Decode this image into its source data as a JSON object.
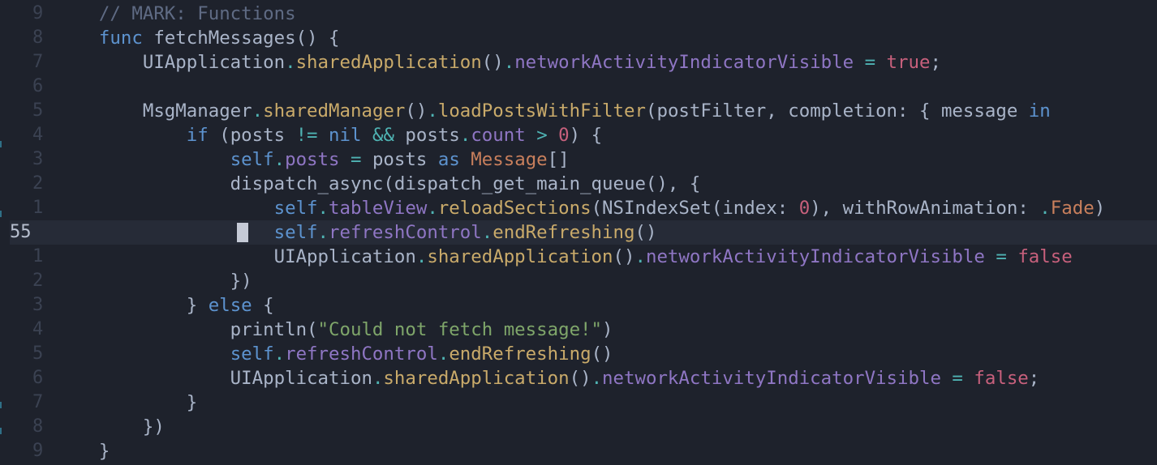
{
  "editor": {
    "current_line_number": "55",
    "lines": [
      {
        "num": "9",
        "tokens": [
          [
            "    ",
            "plain"
          ],
          [
            "// MARK: Functions",
            "comment"
          ]
        ]
      },
      {
        "num": "8",
        "tokens": [
          [
            "    ",
            "plain"
          ],
          [
            "func",
            "kw"
          ],
          [
            " fetchMessages() {",
            "plain"
          ]
        ]
      },
      {
        "num": "7",
        "tokens": [
          [
            "        UIApplication",
            "plain"
          ],
          [
            ".",
            "op"
          ],
          [
            "sharedApplication",
            "fn"
          ],
          [
            "()",
            "plain"
          ],
          [
            ".",
            "op"
          ],
          [
            "networkActivityIndicatorVisible",
            "prop"
          ],
          [
            " ",
            "plain"
          ],
          [
            "=",
            "op"
          ],
          [
            " ",
            "plain"
          ],
          [
            "true",
            "bool"
          ],
          [
            ";",
            "plain"
          ]
        ]
      },
      {
        "num": "6",
        "tokens": []
      },
      {
        "num": "5",
        "tokens": [
          [
            "        MsgManager",
            "plain"
          ],
          [
            ".",
            "op"
          ],
          [
            "sharedManager",
            "fn"
          ],
          [
            "()",
            "plain"
          ],
          [
            ".",
            "op"
          ],
          [
            "loadPostsWithFilter",
            "fn"
          ],
          [
            "(postFilter, completion: { message ",
            "plain"
          ],
          [
            "in",
            "kw"
          ]
        ]
      },
      {
        "num": "4",
        "tokens": [
          [
            "            ",
            "plain"
          ],
          [
            "if",
            "kw"
          ],
          [
            " (posts ",
            "plain"
          ],
          [
            "!=",
            "op"
          ],
          [
            " ",
            "plain"
          ],
          [
            "nil",
            "kw"
          ],
          [
            " ",
            "plain"
          ],
          [
            "&&",
            "op"
          ],
          [
            " posts",
            "plain"
          ],
          [
            ".",
            "op"
          ],
          [
            "count",
            "prop"
          ],
          [
            " ",
            "plain"
          ],
          [
            ">",
            "op"
          ],
          [
            " ",
            "plain"
          ],
          [
            "0",
            "num"
          ],
          [
            ") {",
            "plain"
          ]
        ]
      },
      {
        "num": "3",
        "tokens": [
          [
            "                ",
            "plain"
          ],
          [
            "self",
            "kw"
          ],
          [
            ".",
            "op"
          ],
          [
            "posts",
            "prop"
          ],
          [
            " ",
            "plain"
          ],
          [
            "=",
            "op"
          ],
          [
            " posts ",
            "plain"
          ],
          [
            "as",
            "kw"
          ],
          [
            " ",
            "plain"
          ],
          [
            "Message",
            "type"
          ],
          [
            "[]",
            "plain"
          ]
        ]
      },
      {
        "num": "2",
        "tokens": [
          [
            "                dispatch_async(dispatch_get_main_queue(), {",
            "plain"
          ]
        ]
      },
      {
        "num": "1",
        "tokens": [
          [
            "                    ",
            "plain"
          ],
          [
            "self",
            "kw"
          ],
          [
            ".",
            "op"
          ],
          [
            "tableView",
            "prop"
          ],
          [
            ".",
            "op"
          ],
          [
            "reloadSections",
            "fn"
          ],
          [
            "(NSIndexSet(index: ",
            "plain"
          ],
          [
            "0",
            "num"
          ],
          [
            "), withRowAnimation: ",
            "plain"
          ],
          [
            ".",
            "op"
          ],
          [
            "Fade",
            "type"
          ],
          [
            ")",
            "plain"
          ]
        ]
      },
      {
        "num": "55",
        "current": true,
        "tokens": [
          [
            "                    ",
            "plain"
          ],
          [
            "self",
            "kw"
          ],
          [
            ".",
            "op"
          ],
          [
            "refreshControl",
            "prop"
          ],
          [
            ".",
            "op"
          ],
          [
            "endRefreshing",
            "fn"
          ],
          [
            "()",
            "plain"
          ]
        ]
      },
      {
        "num": "1",
        "tokens": [
          [
            "                    UIApplication",
            "plain"
          ],
          [
            ".",
            "op"
          ],
          [
            "sharedApplication",
            "fn"
          ],
          [
            "()",
            "plain"
          ],
          [
            ".",
            "op"
          ],
          [
            "networkActivityIndicatorVisible",
            "prop"
          ],
          [
            " ",
            "plain"
          ],
          [
            "=",
            "op"
          ],
          [
            " ",
            "plain"
          ],
          [
            "false",
            "bool"
          ]
        ]
      },
      {
        "num": "2",
        "tokens": [
          [
            "                })",
            "plain"
          ]
        ]
      },
      {
        "num": "3",
        "tokens": [
          [
            "            } ",
            "plain"
          ],
          [
            "else",
            "kw"
          ],
          [
            " {",
            "plain"
          ]
        ]
      },
      {
        "num": "4",
        "tokens": [
          [
            "                println(",
            "plain"
          ],
          [
            "\"Could not fetch message!\"",
            "str"
          ],
          [
            ")",
            "plain"
          ]
        ]
      },
      {
        "num": "5",
        "tokens": [
          [
            "                ",
            "plain"
          ],
          [
            "self",
            "kw"
          ],
          [
            ".",
            "op"
          ],
          [
            "refreshControl",
            "prop"
          ],
          [
            ".",
            "op"
          ],
          [
            "endRefreshing",
            "fn"
          ],
          [
            "()",
            "plain"
          ]
        ]
      },
      {
        "num": "6",
        "tokens": [
          [
            "                UIApplication",
            "plain"
          ],
          [
            ".",
            "op"
          ],
          [
            "sharedApplication",
            "fn"
          ],
          [
            "()",
            "plain"
          ],
          [
            ".",
            "op"
          ],
          [
            "networkActivityIndicatorVisible",
            "prop"
          ],
          [
            " ",
            "plain"
          ],
          [
            "=",
            "op"
          ],
          [
            " ",
            "plain"
          ],
          [
            "false",
            "bool"
          ],
          [
            ";",
            "plain"
          ]
        ]
      },
      {
        "num": "7",
        "tokens": [
          [
            "            }",
            "plain"
          ]
        ]
      },
      {
        "num": "8",
        "tokens": [
          [
            "        })",
            "plain"
          ]
        ]
      },
      {
        "num": "9",
        "tokens": [
          [
            "    }",
            "plain"
          ]
        ]
      }
    ]
  }
}
